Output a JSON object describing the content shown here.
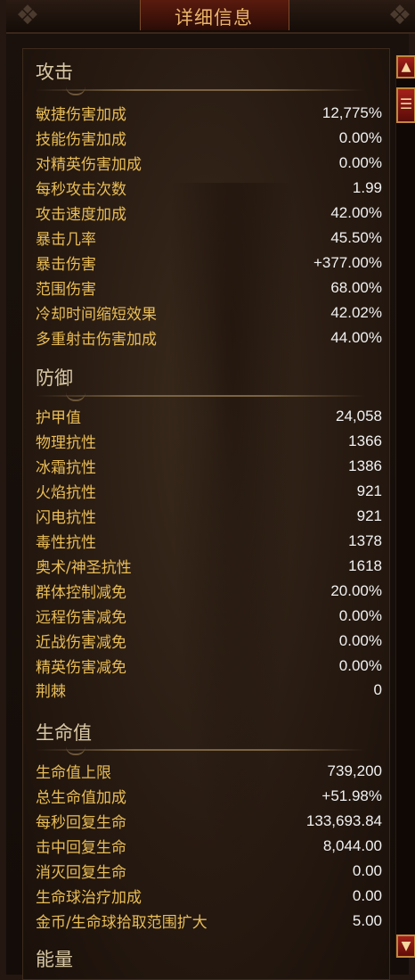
{
  "window": {
    "title": "详细信息"
  },
  "sections": {
    "attack": {
      "title": "攻击",
      "rows": [
        {
          "label": "敏捷伤害加成",
          "value": "12,775%"
        },
        {
          "label": "技能伤害加成",
          "value": "0.00%"
        },
        {
          "label": "对精英伤害加成",
          "value": "0.00%"
        },
        {
          "label": "每秒攻击次数",
          "value": "1.99"
        },
        {
          "label": "攻击速度加成",
          "value": "42.00%"
        },
        {
          "label": "暴击几率",
          "value": "45.50%"
        },
        {
          "label": "暴击伤害",
          "value": "+377.00%"
        },
        {
          "label": "范围伤害",
          "value": "68.00%"
        },
        {
          "label": "冷却时间缩短效果",
          "value": "42.02%"
        },
        {
          "label": "多重射击伤害加成",
          "value": "44.00%"
        }
      ]
    },
    "defense": {
      "title": "防御",
      "rows": [
        {
          "label": "护甲值",
          "value": "24,058"
        },
        {
          "label": "物理抗性",
          "value": "1366"
        },
        {
          "label": "冰霜抗性",
          "value": "1386"
        },
        {
          "label": "火焰抗性",
          "value": "921"
        },
        {
          "label": "闪电抗性",
          "value": "921"
        },
        {
          "label": "毒性抗性",
          "value": "1378"
        },
        {
          "label": "奥术/神圣抗性",
          "value": "1618"
        },
        {
          "label": "群体控制减免",
          "value": "20.00%"
        },
        {
          "label": "远程伤害减免",
          "value": "0.00%"
        },
        {
          "label": "近战伤害减免",
          "value": "0.00%"
        },
        {
          "label": "精英伤害减免",
          "value": "0.00%"
        },
        {
          "label": "荆棘",
          "value": "0"
        }
      ]
    },
    "life": {
      "title": "生命值",
      "rows": [
        {
          "label": "生命值上限",
          "value": "739,200"
        },
        {
          "label": "总生命值加成",
          "value": "+51.98%"
        },
        {
          "label": "每秒回复生命",
          "value": "133,693.84"
        },
        {
          "label": "击中回复生命",
          "value": "8,044.00"
        },
        {
          "label": "消灭回复生命",
          "value": "0.00"
        },
        {
          "label": "生命球治疗加成",
          "value": "0.00"
        },
        {
          "label": "金币/生命球拾取范围扩大",
          "value": "5.00"
        }
      ]
    },
    "next": {
      "title_partial": "能量"
    }
  },
  "scrollbar": {
    "up_glyph": "▲",
    "down_glyph": "▼",
    "thumb_glyph": "☰"
  },
  "colors": {
    "label": "#e9bd57",
    "value": "#f1f1f1",
    "section_title": "#d8c8a4",
    "title": "#e9b36a"
  }
}
